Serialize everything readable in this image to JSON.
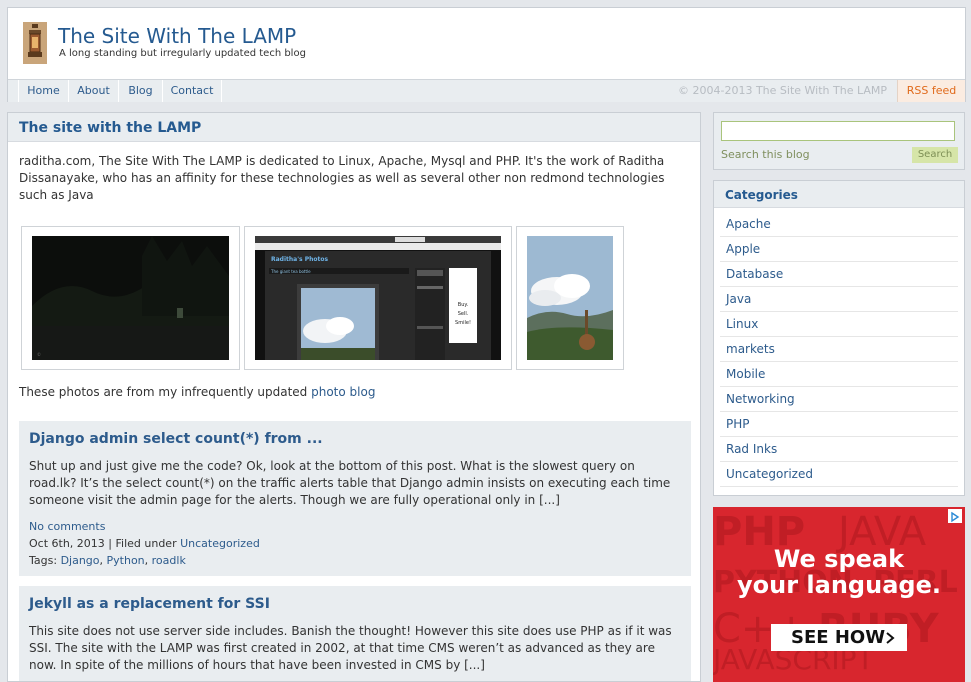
{
  "header": {
    "title": "The Site With The LAMP",
    "tagline": "A long standing but irregularly updated tech blog",
    "logo_icon": "lantern-icon"
  },
  "nav": {
    "items": [
      {
        "label": "Home"
      },
      {
        "label": "About"
      },
      {
        "label": "Blog"
      },
      {
        "label": "Contact"
      }
    ],
    "copyright": "© 2004-2013 The Site With The LAMP",
    "rss": "RSS feed"
  },
  "intro": {
    "heading": "The site with the LAMP",
    "text": "raditha.com, The Site With The LAMP is dedicated to Linux, Apache, Mysql and PHP. It's the work of Raditha Dissanayake, who has an affinity for these technologies as well as several other non redmond technologies such as Java",
    "photo_note_before": "These photos are from my infrequently updated ",
    "photo_note_link": "photo blog",
    "screenshot_photo": {
      "site_name": "Raditha's Photos",
      "post_title": "The giant tea bottle",
      "side_text_1": "Buy.",
      "side_text_2": "Sell.",
      "side_text_3": "Smile!"
    }
  },
  "posts": [
    {
      "title": "Django admin select count(*) from ...",
      "excerpt": "Shut up and just give me the code? Ok, look at the bottom of this post. What is the slowest query on road.lk? It’s the select count(*) on the traffic alerts table that Django admin insists on executing each time someone visit the admin page for the alerts. Though we are fully operational only in [...]",
      "comments": "No comments",
      "date": "Oct 6th, 2013",
      "filed_label": "Filed under",
      "category": "Uncategorized",
      "tags_label": "Tags:",
      "tags": [
        "Django",
        "Python",
        "roadlk"
      ]
    },
    {
      "title": "Jekyll as a replacement for SSI",
      "excerpt": "This site does not use server side includes.  Banish the thought! However this site does use PHP as if it was SSI. The site with the LAMP was first created in 2002, at that time CMS weren’t as advanced as they are now. In spite of the millions of hours that have been invested in CMS by [...]"
    }
  ],
  "sidebar": {
    "search_placeholder": "",
    "search_label": "Search this blog",
    "search_button": "Search",
    "categories_heading": "Categories",
    "categories": [
      "Apache",
      "Apple",
      "Database",
      "Java",
      "Linux",
      "markets",
      "Mobile",
      "Networking",
      "PHP",
      "Rad Inks",
      "Uncategorized"
    ]
  },
  "ad": {
    "line1": "We speak",
    "line2": "your language.",
    "cta": "SEE HOW",
    "bg_words": [
      "PHP",
      "JAVA",
      "PYTHON",
      "PERL",
      "C++",
      "RUBY",
      "JAVASCRIPT"
    ]
  },
  "colors": {
    "link": "#2d5b8c",
    "heading": "#255a90",
    "panel_bg": "#e9edf0",
    "rss": "#e06a1b",
    "ad_red": "#d8262e"
  }
}
